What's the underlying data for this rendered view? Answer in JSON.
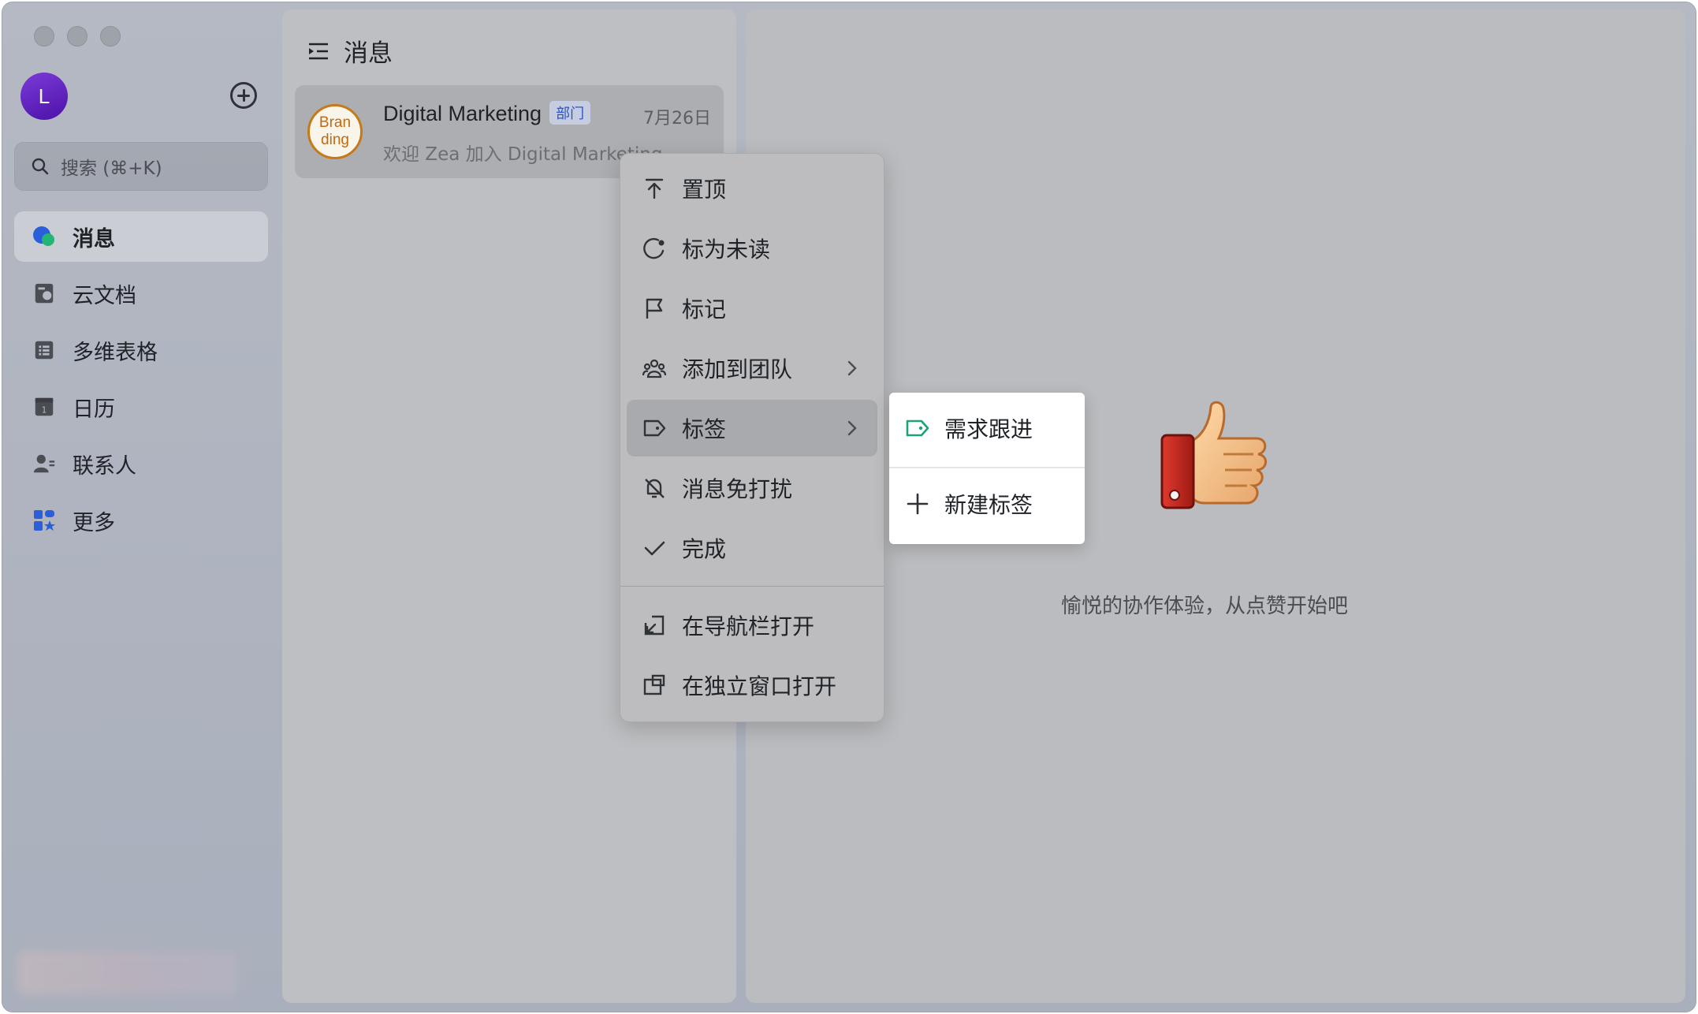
{
  "sidebar": {
    "avatar_initial": "L",
    "search_placeholder": "搜索 (⌘+K)",
    "items": [
      {
        "label": "消息",
        "icon": "message-icon",
        "active": true
      },
      {
        "label": "云文档",
        "icon": "docs-icon"
      },
      {
        "label": "多维表格",
        "icon": "table-icon"
      },
      {
        "label": "日历",
        "icon": "calendar-icon"
      },
      {
        "label": "联系人",
        "icon": "contacts-icon"
      },
      {
        "label": "更多",
        "icon": "more-apps-icon"
      }
    ]
  },
  "messages": {
    "title": "消息",
    "chats": [
      {
        "avatar_text_line1": "Bran",
        "avatar_text_line2": "ding",
        "name": "Digital Marketing",
        "badge": "部门",
        "date": "7月26日",
        "preview": "欢迎 Zea 加入 Digital Marketing"
      }
    ]
  },
  "context_menu": {
    "items": [
      {
        "label": "置顶",
        "icon": "pin-to-top-icon"
      },
      {
        "label": "标为未读",
        "icon": "mark-unread-icon"
      },
      {
        "label": "标记",
        "icon": "flag-icon"
      },
      {
        "label": "添加到团队",
        "icon": "team-icon",
        "submenu": true
      },
      {
        "label": "标签",
        "icon": "tag-icon",
        "submenu": true,
        "highlighted": true
      },
      {
        "label": "消息免打扰",
        "icon": "bell-off-icon"
      },
      {
        "label": "完成",
        "icon": "check-icon"
      },
      {
        "label": "在导航栏打开",
        "icon": "open-in-nav-icon"
      },
      {
        "label": "在独立窗口打开",
        "icon": "open-in-window-icon"
      }
    ]
  },
  "tag_submenu": {
    "items": [
      {
        "label": "需求跟进",
        "icon": "tag-icon",
        "color": "#1aa37a"
      },
      {
        "label": "新建标签",
        "icon": "plus-icon"
      }
    ]
  },
  "empty_state": {
    "text": "愉悦的协作体验，从点赞开始吧",
    "icon": "thumbs-up-icon"
  }
}
